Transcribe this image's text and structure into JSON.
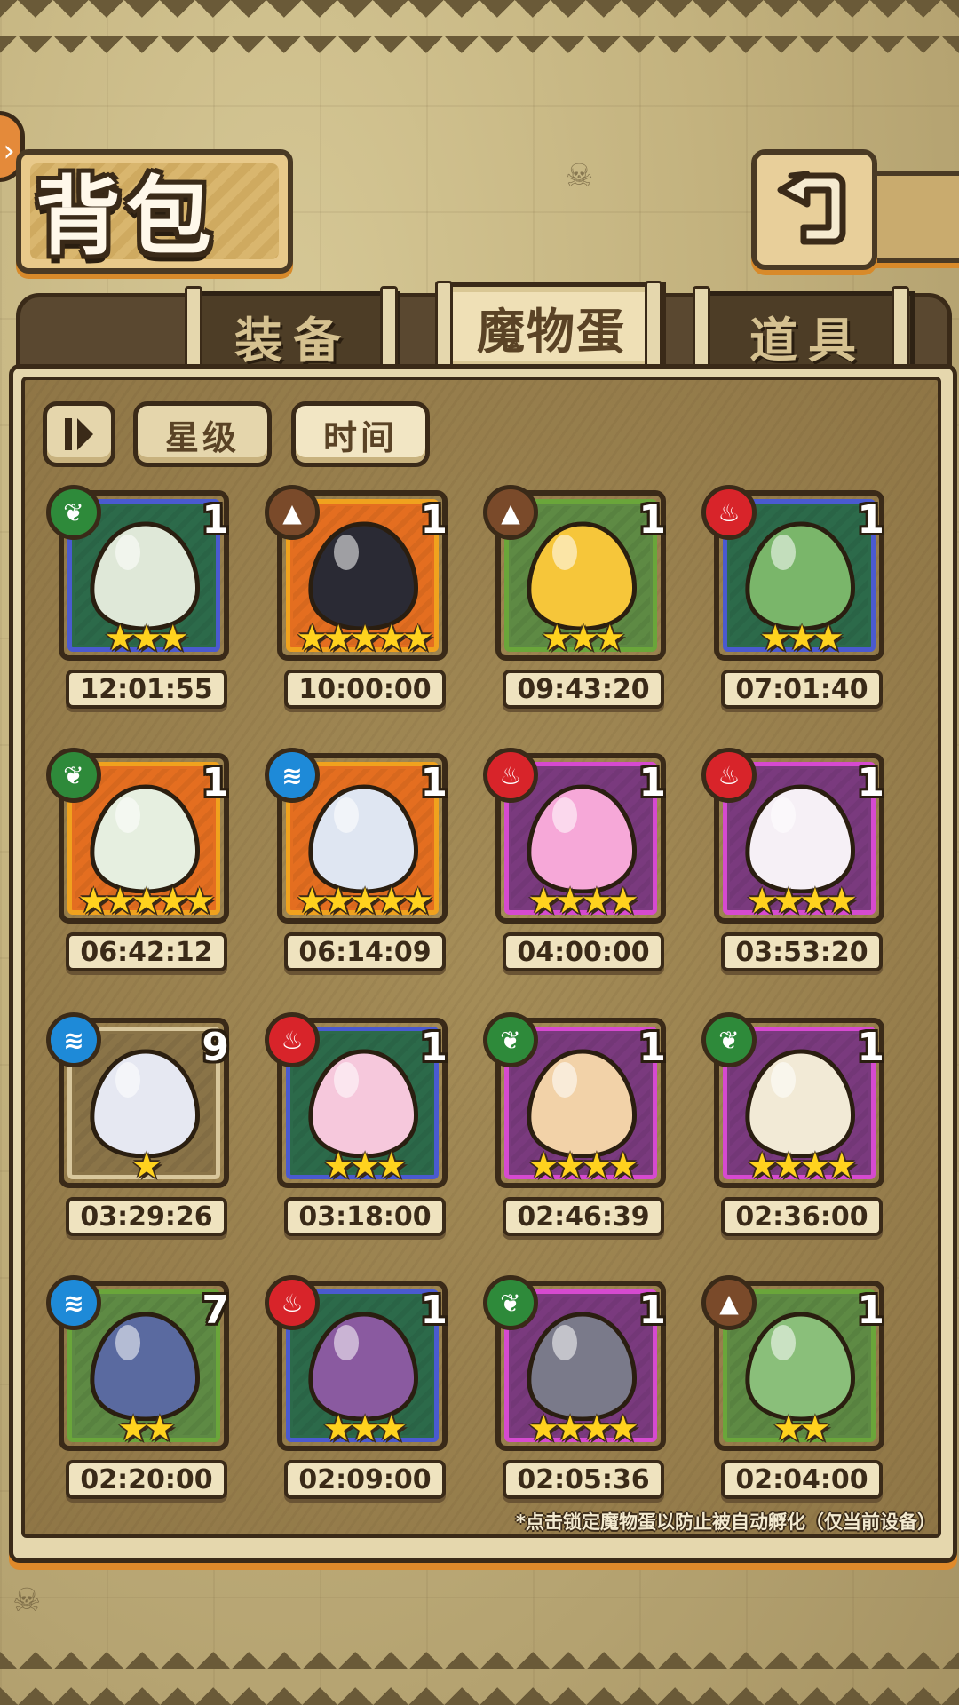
{
  "header": {
    "title": "背包",
    "back_icon": "return-arrow-icon"
  },
  "tabs": [
    {
      "label": "装备",
      "active": false
    },
    {
      "label": "魔物蛋",
      "active": true
    },
    {
      "label": "道具",
      "active": false
    }
  ],
  "filters": {
    "pause_icon": "sort-toggle-icon",
    "star_label": "星级",
    "time_label": "时间"
  },
  "eggs": [
    {
      "element": "grass",
      "count": "1",
      "stars": "★★★",
      "time": "12:01:55",
      "rim": "#4a5ad0",
      "fill": "#2c6a4a"
    },
    {
      "element": "earth",
      "count": "1",
      "stars": "★★★★★",
      "time": "10:00:00",
      "rim": "#f0a21e",
      "fill": "#e46e20"
    },
    {
      "element": "earth",
      "count": "1",
      "stars": "★★★",
      "time": "09:43:20",
      "rim": "#6aa63a",
      "fill": "#5e8a44"
    },
    {
      "element": "fire",
      "count": "1",
      "stars": "★★★",
      "time": "07:01:40",
      "rim": "#4a5ad0",
      "fill": "#2c6a4a"
    },
    {
      "element": "grass",
      "count": "1",
      "stars": "★★★★★",
      "time": "06:42:12",
      "rim": "#f0a21e",
      "fill": "#e46e20"
    },
    {
      "element": "water",
      "count": "1",
      "stars": "★★★★★",
      "time": "06:14:09",
      "rim": "#f0a21e",
      "fill": "#e46e20"
    },
    {
      "element": "fire",
      "count": "1",
      "stars": "★★★★",
      "time": "04:00:00",
      "rim": "#d64ad0",
      "fill": "#7a3a7e"
    },
    {
      "element": "fire",
      "count": "1",
      "stars": "★★★★",
      "time": "03:53:20",
      "rim": "#d64ad0",
      "fill": "#7a3a7e"
    },
    {
      "element": "water",
      "count": "9",
      "stars": "★",
      "time": "03:29:26",
      "rim": "#d8c79c",
      "fill": "#8a7448"
    },
    {
      "element": "fire",
      "count": "1",
      "stars": "★★★",
      "time": "03:18:00",
      "rim": "#4a5ad0",
      "fill": "#2c6a4a"
    },
    {
      "element": "grass",
      "count": "1",
      "stars": "★★★★",
      "time": "02:46:39",
      "rim": "#d64ad0",
      "fill": "#7a3a7e"
    },
    {
      "element": "grass",
      "count": "1",
      "stars": "★★★★",
      "time": "02:36:00",
      "rim": "#d64ad0",
      "fill": "#7a3a7e"
    },
    {
      "element": "water",
      "count": "7",
      "stars": "★★",
      "time": "02:20:00",
      "rim": "#6aa63a",
      "fill": "#5e8a44"
    },
    {
      "element": "fire",
      "count": "1",
      "stars": "★★★",
      "time": "02:09:00",
      "rim": "#4a5ad0",
      "fill": "#2c6a4a"
    },
    {
      "element": "grass",
      "count": "1",
      "stars": "★★★★",
      "time": "02:05:36",
      "rim": "#d64ad0",
      "fill": "#7a3a7e"
    },
    {
      "element": "earth",
      "count": "1",
      "stars": "★★",
      "time": "02:04:00",
      "rim": "#6aa63a",
      "fill": "#5e8a44"
    }
  ],
  "element_colors": {
    "grass": "#2e8a3a",
    "earth": "#7a4a2a",
    "fire": "#d8242a",
    "water": "#1e8ad8"
  },
  "footnote": "*点击锁定魔物蛋以防止被自动孵化（仅当前设备）"
}
